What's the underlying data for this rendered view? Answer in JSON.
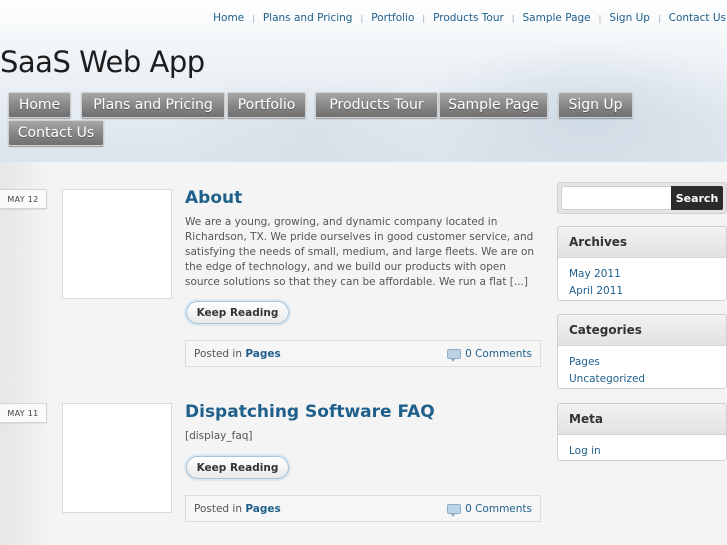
{
  "top_nav": [
    "Home",
    "Plans and Pricing",
    "Portfolio",
    "Products Tour",
    "Sample Page",
    "Sign Up",
    "Contact Us"
  ],
  "site_title": "SaaS Web App",
  "main_nav": [
    "Home",
    "Plans and Pricing",
    "Portfolio",
    "Products Tour",
    "Sample Page",
    "Sign Up",
    "Contact Us"
  ],
  "posts": [
    {
      "date": "MAY 12",
      "title": "About",
      "excerpt": "We are a young, growing, and dynamic company located in Richardson, TX. We pride ourselves in good customer service, and satisfying the needs of small, medium, and large fleets. We are on the edge of technology, and we build our products with open source solutions so that they can be affordable. We run a flat [...]",
      "keep_reading": "Keep Reading",
      "posted_in_label": "Posted in",
      "category": "Pages",
      "comments": "0 Comments"
    },
    {
      "date": "MAY 11",
      "title": "Dispatching Software FAQ",
      "excerpt": "[display_faq]",
      "keep_reading": "Keep Reading",
      "posted_in_label": "Posted in",
      "category": "Pages",
      "comments": "0 Comments"
    }
  ],
  "search": {
    "placeholder": "",
    "button": "Search"
  },
  "widgets": {
    "archives": {
      "title": "Archives",
      "items": [
        "May 2011",
        "April 2011"
      ]
    },
    "categories": {
      "title": "Categories",
      "items": [
        "Pages",
        "Uncategorized"
      ]
    },
    "meta": {
      "title": "Meta",
      "items": [
        "Log in"
      ]
    }
  }
}
